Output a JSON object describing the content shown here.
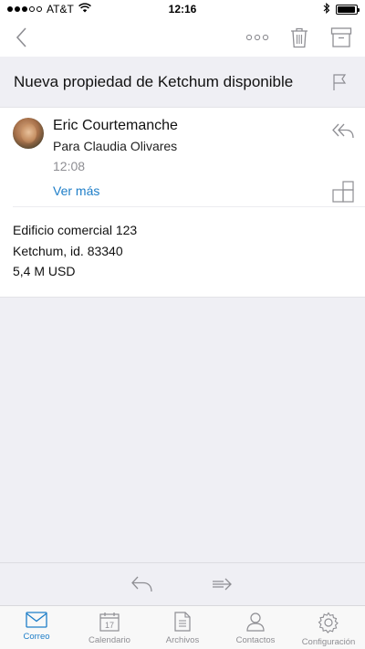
{
  "status_bar": {
    "carrier": "AT&T",
    "time": "12:16",
    "signal_bars_filled": 3,
    "signal_bars_total": 5,
    "battery_level": 0.95
  },
  "nav": {
    "back_icon": "chevron-left-icon",
    "more_icon": "more-horizontal-icon",
    "delete_icon": "trash-icon",
    "archive_icon": "archive-icon"
  },
  "subject": {
    "text": "Nueva propiedad de Ketchum disponible",
    "flag_icon": "flag-icon"
  },
  "message": {
    "sender": "Eric Courtemanche",
    "recipients": "Para Claudia Olivares",
    "time": "12:08",
    "see_more": "Ver más",
    "body_lines": [
      "Edificio comercial 123",
      "Ketchum, id. 83340",
      "5,4 M USD"
    ]
  },
  "actions": {
    "reply_icon": "reply-icon",
    "forward_icon": "forward-icon"
  },
  "tabs": [
    {
      "label": "Correo",
      "icon": "mail-icon",
      "active": true
    },
    {
      "label": "Calendario",
      "icon": "calendar-icon",
      "active": false,
      "day": "17"
    },
    {
      "label": "Archivos",
      "icon": "files-icon",
      "active": false
    },
    {
      "label": "Contactos",
      "icon": "contacts-icon",
      "active": false
    },
    {
      "label": "Configuración",
      "icon": "settings-icon",
      "active": false
    }
  ],
  "colors": {
    "accent": "#1e7ec8",
    "background": "#efeff4",
    "icon_gray": "#8e8e93"
  }
}
